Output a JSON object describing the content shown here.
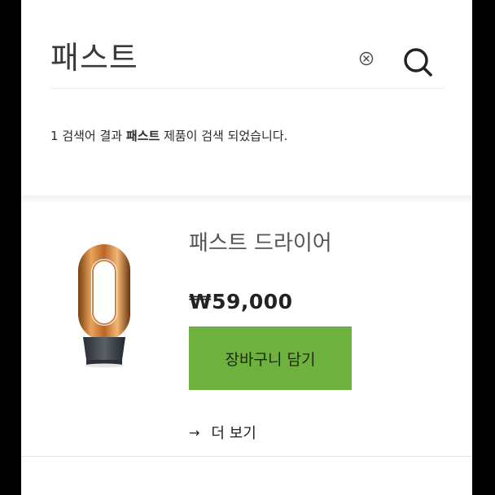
{
  "search": {
    "query": "패스트",
    "clear_icon": "close-circle-icon",
    "search_icon": "search-icon"
  },
  "results": {
    "count": "1",
    "text_part1": "검색어 결과",
    "query_bold": "패스트",
    "text_part2": "제품이 검색 되었습니다."
  },
  "product": {
    "name": "패스트 드라이어",
    "price": "₩59,000",
    "add_to_cart_label": "장바구니 담기",
    "more_label": "더 보기",
    "more_arrow": "→",
    "button_color": "#6fb13e",
    "image_icon": "hair-dryer-image"
  }
}
